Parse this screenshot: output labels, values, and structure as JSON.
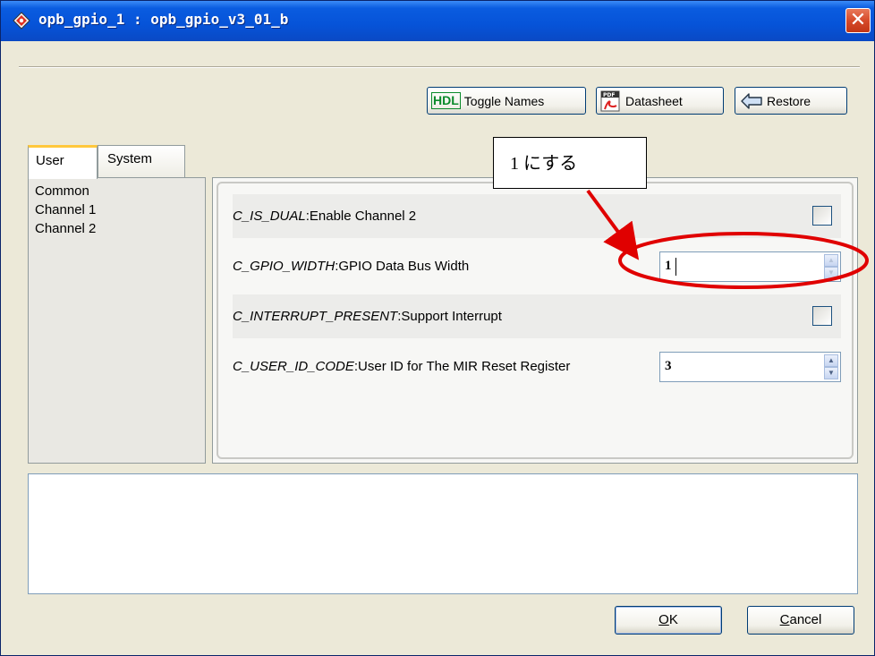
{
  "window": {
    "title": "opb_gpio_1 : opb_gpio_v3_01_b",
    "close_glyph": "✕"
  },
  "toolbar": {
    "hdl_icon_text": "HDL",
    "toggle_names_label": "Toggle Names",
    "datasheet_label": "Datasheet",
    "restore_label": "Restore"
  },
  "tabs": [
    {
      "label": "User",
      "selected": true
    },
    {
      "label": "System",
      "selected": false
    }
  ],
  "categories": [
    "Common",
    "Channel 1",
    "Channel 2"
  ],
  "params": [
    {
      "name": "C_IS_DUAL",
      "desc": "Enable Channel 2",
      "control": "checkbox",
      "checked": false
    },
    {
      "name": "C_GPIO_WIDTH",
      "desc": "GPIO Data Bus Width",
      "control": "spinner",
      "value": "1"
    },
    {
      "name": "C_INTERRUPT_PRESENT",
      "desc": "Support Interrupt",
      "control": "checkbox",
      "checked": false
    },
    {
      "name": "C_USER_ID_CODE",
      "desc": "User ID for The MIR Reset Register",
      "control": "spinner",
      "value": "3"
    }
  ],
  "annotation": {
    "callout_text": "1 にする",
    "color": "#e00000"
  },
  "buttons": {
    "ok_mnemonic": "O",
    "ok_rest": "K",
    "cancel_mnemonic": "C",
    "cancel_rest": "ancel"
  },
  "colors": {
    "titlebar": "#0653d8",
    "dialog_bg": "#ece9d8",
    "tab_accent": "#ffc83c"
  }
}
